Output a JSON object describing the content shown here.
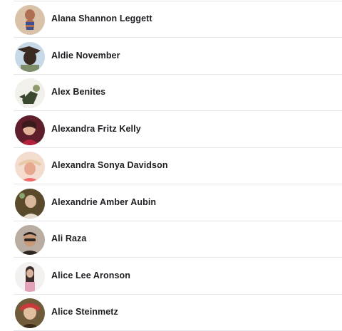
{
  "friends": [
    {
      "name": "Alana Shannon Leggett",
      "avatar_colors": {
        "bg": "#d9c2a8",
        "fg": "#b06f52",
        "accent": "#3c4f8f"
      }
    },
    {
      "name": "Aldie November",
      "avatar_colors": {
        "bg": "#c7d8e6",
        "fg": "#3a2a22",
        "accent": "#7e8d6a"
      }
    },
    {
      "name": "Alex Benites",
      "avatar_colors": {
        "bg": "#f2f0ea",
        "fg": "#3b4a2e",
        "accent": "#8f9b6a"
      }
    },
    {
      "name": "Alexandra Fritz Kelly",
      "avatar_colors": {
        "bg": "#5e1f2a",
        "fg": "#e2b39a",
        "accent": "#b3213a"
      }
    },
    {
      "name": "Alexandra Sonya Davidson",
      "avatar_colors": {
        "bg": "#f4dccf",
        "fg": "#e6a98f",
        "accent": "#f06a6a"
      }
    },
    {
      "name": "Alexandrie Amber Aubin",
      "avatar_colors": {
        "bg": "#5a4a2c",
        "fg": "#d8b89a",
        "accent": "#e6dccf"
      }
    },
    {
      "name": "Ali Raza",
      "avatar_colors": {
        "bg": "#b9aca0",
        "fg": "#2a2522",
        "accent": "#d7cfc6"
      }
    },
    {
      "name": "Alice Lee Aronson",
      "avatar_colors": {
        "bg": "#f3f0f0",
        "fg": "#3b2d2a",
        "accent": "#e3a2b8"
      }
    },
    {
      "name": "Alice Steinmetz",
      "avatar_colors": {
        "bg": "#6f5a3a",
        "fg": "#e0bfa0",
        "accent": "#c93a3a"
      }
    }
  ]
}
